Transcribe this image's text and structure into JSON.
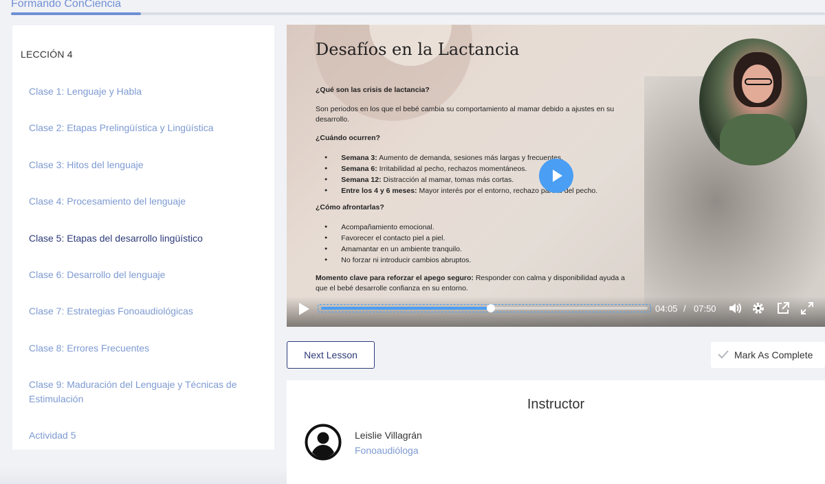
{
  "app": {
    "brand": "Formando ConCiencia",
    "progress": 0.16
  },
  "sidebar": {
    "lesson_heading": "LECCIÓN 4",
    "items": [
      {
        "label": "Clase 1: Lenguaje y Habla",
        "active": false
      },
      {
        "label": "Clase 2: Etapas Prelingüística y Lingüística",
        "active": false
      },
      {
        "label": "Clase 3: Hitos del lenguaje",
        "active": false
      },
      {
        "label": "Clase 4: Procesamiento del lenguaje",
        "active": false
      },
      {
        "label": "Clase 5: Etapas del desarrollo lingüístico",
        "active": true
      },
      {
        "label": "Clase 6: Desarrollo del lenguaje",
        "active": false
      },
      {
        "label": "Clase 7: Estrategias Fonoaudiológicas",
        "active": false
      },
      {
        "label": "Clase 8: Errores Frecuentes",
        "active": false
      },
      {
        "label": "Clase 9: Maduración del Lenguaje y Técnicas de Estimulación",
        "active": false
      },
      {
        "label": "Actividad 5",
        "active": false
      }
    ]
  },
  "slide": {
    "title": "Desafíos en la Lactancia",
    "q1": "¿Qué son las crisis de lactancia?",
    "a1": "Son periodos en los que el bebé cambia su comportamiento al mamar debido a ajustes en su desarrollo.",
    "q2": "¿Cuándo ocurren?",
    "when": [
      {
        "bold": "Semana 3:",
        "text": " Aumento de demanda, sesiones más largas y frecuentes."
      },
      {
        "bold": "Semana 6:",
        "text": " Irritabilidad al pecho, rechazos momentáneos."
      },
      {
        "bold": "Semana 12:",
        "text": " Distracción al mamar, tomas más cortas."
      },
      {
        "bold": "Entre los 4 y 6 meses:",
        "text": " Mayor interés por el entorno, rechazo parcial del pecho."
      }
    ],
    "q3": "¿Cómo afrontarlas?",
    "how": [
      "Acompañamiento emocional.",
      "Favorecer el contacto piel a piel.",
      "Amamantar en un ambiente tranquilo.",
      "No forzar ni introducir cambios abruptos."
    ],
    "key_bold": "Momento clave para reforzar el apego seguro:",
    "key_text": " Responder con calma y disponibilidad ayuda a que el bebé desarrolle confianza en su entorno."
  },
  "player": {
    "current_time": "04:05",
    "separator": "/",
    "duration": "07:50",
    "played_fraction": 0.52
  },
  "actions": {
    "next_label": "Next Lesson",
    "complete_label": "Mark As Complete"
  },
  "instructor": {
    "heading": "Instructor",
    "name": "Leislie Villagrán",
    "role": "Fonoaudióloga"
  },
  "colors": {
    "accent": "#6f8fd4",
    "link": "#7d9ad1",
    "active": "#2d3a78",
    "player_blue": "#4a9ef3"
  }
}
